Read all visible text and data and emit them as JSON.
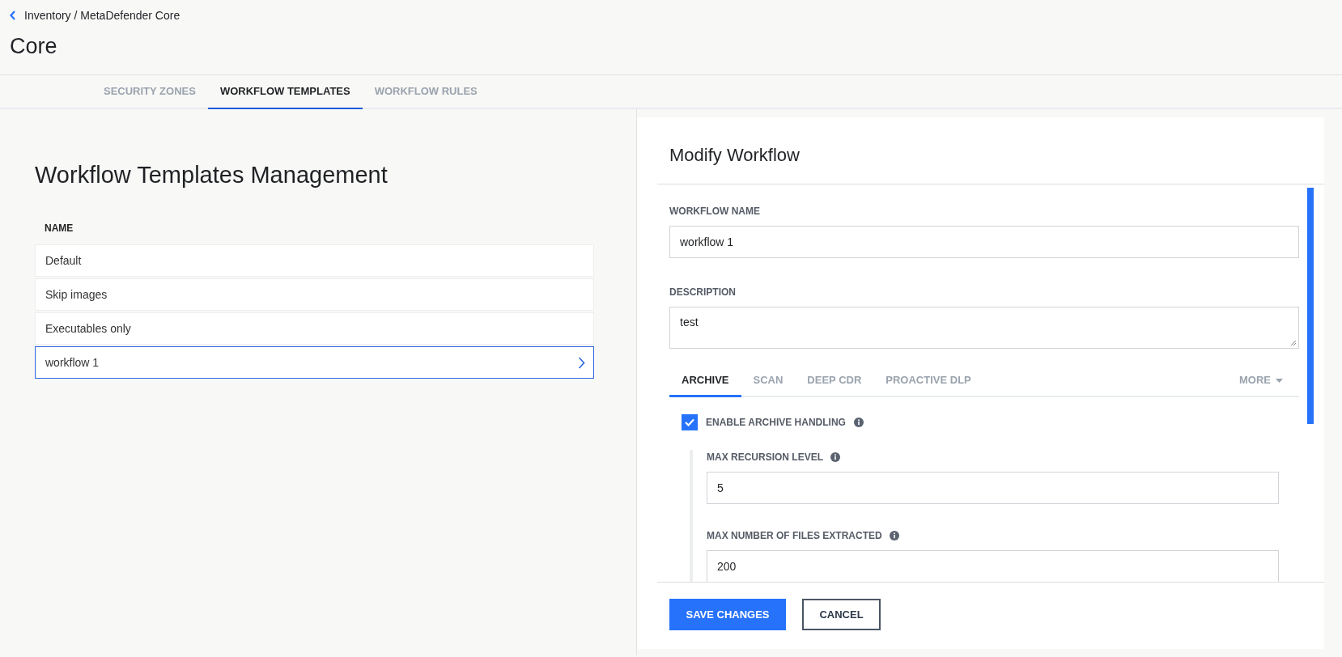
{
  "breadcrumb": "Inventory / MetaDefender Core",
  "page_title": "Core",
  "tabs": [
    {
      "label": "SECURITY ZONES",
      "selected": false
    },
    {
      "label": "WORKFLOW TEMPLATES",
      "selected": true
    },
    {
      "label": "WORKFLOW RULES",
      "selected": false
    }
  ],
  "templates": {
    "title": "Workflow Templates Management",
    "column": "NAME",
    "rows": [
      {
        "name": "Default",
        "selected": false
      },
      {
        "name": "Skip images",
        "selected": false
      },
      {
        "name": "Executables only",
        "selected": false
      },
      {
        "name": "workflow 1",
        "selected": true
      }
    ]
  },
  "modify_panel": {
    "title": "Modify Workflow",
    "workflow_name": {
      "label": "WORKFLOW NAME",
      "value": "workflow 1"
    },
    "description": {
      "label": "DESCRIPTION",
      "value": "test"
    },
    "tabs": [
      {
        "label": "ARCHIVE",
        "selected": true
      },
      {
        "label": "SCAN",
        "selected": false
      },
      {
        "label": "DEEP CDR",
        "selected": false
      },
      {
        "label": "PROACTIVE DLP",
        "selected": false
      }
    ],
    "more": "MORE",
    "enable_archive": {
      "label": "ENABLE ARCHIVE HANDLING",
      "checked": true
    },
    "fields": [
      {
        "label": "MAX RECURSION LEVEL",
        "value": "5"
      },
      {
        "label": "MAX NUMBER OF FILES EXTRACTED",
        "value": "200"
      }
    ],
    "buttons": {
      "save": "SAVE CHANGES",
      "cancel": "CANCEL"
    }
  }
}
